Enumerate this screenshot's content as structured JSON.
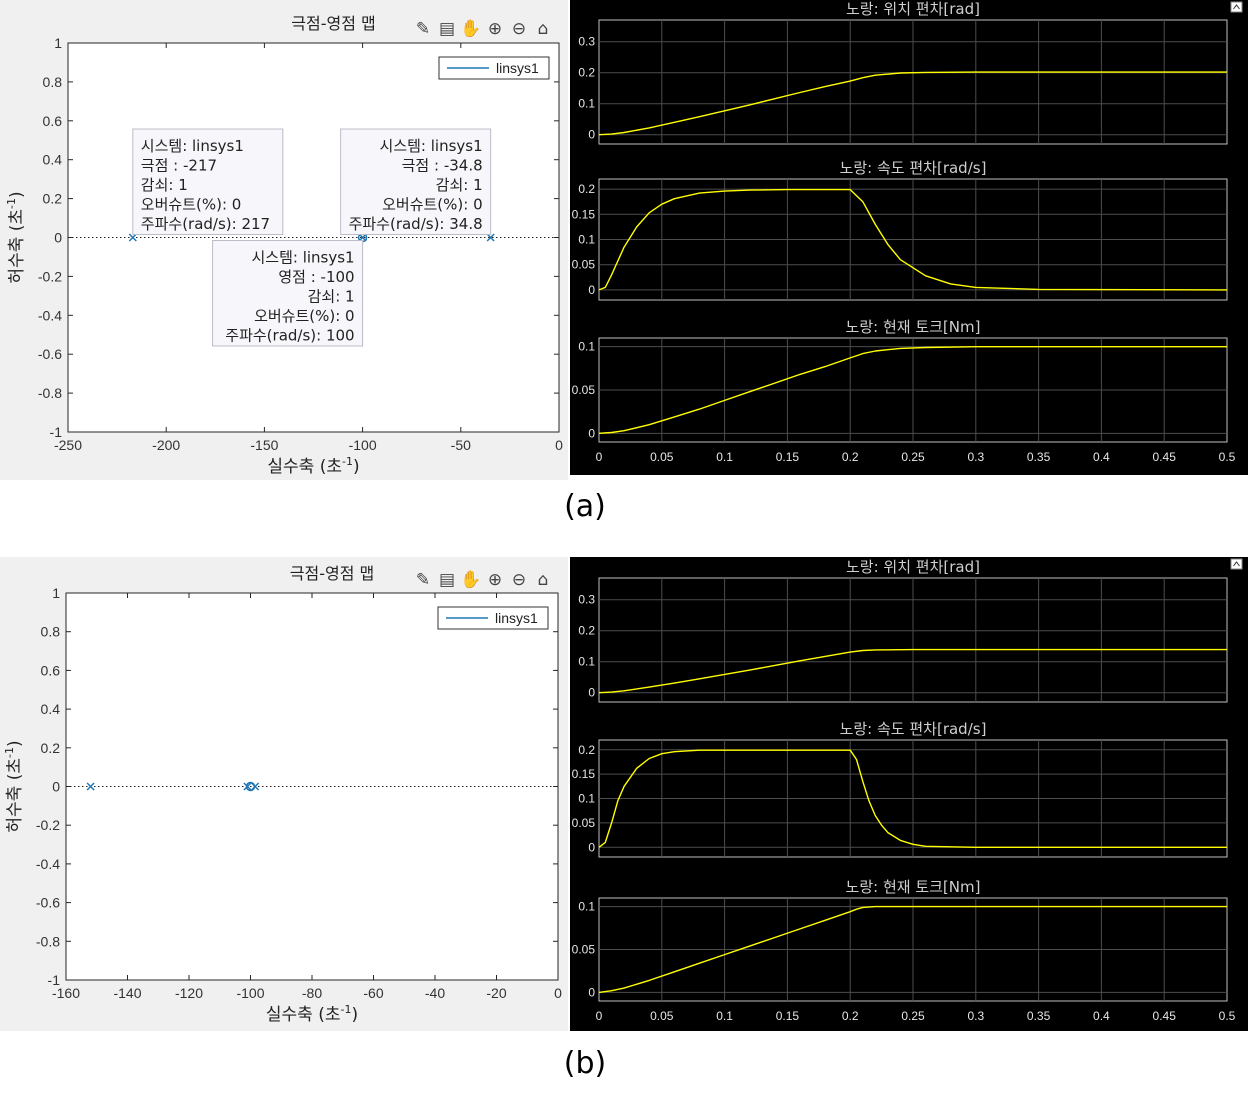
{
  "captions": {
    "a": "(a)",
    "b": "(b)"
  },
  "toolbar_icons": [
    "brush-icon",
    "datatip-icon",
    "pan-hand-icon",
    "zoom-in-icon",
    "zoom-out-icon",
    "home-icon"
  ],
  "scope_toolbar_icon": "undock-icon",
  "colors": {
    "pz_series": "#1f77b4",
    "scope_trace": "#ffff00",
    "scope_bg": "#000000",
    "pz_bg": "#ffffff"
  },
  "figures": [
    {
      "id": "a",
      "chart_data": [
        {
          "type": "scatter",
          "title": "극점-영점 맵",
          "xlabel": "실수축  (초",
          "xlabel_sup": "-1",
          "xlabel_close": ")",
          "ylabel": "허수축  (초",
          "ylabel_sup": "-1",
          "ylabel_close": ")",
          "xlim": [
            -250,
            0
          ],
          "ylim": [
            -1,
            1
          ],
          "xticks": [
            "-250",
            "-200",
            "-150",
            "-100",
            "-50",
            "0"
          ],
          "yticks": [
            "1",
            "0.8",
            "0.6",
            "0.4",
            "0.2",
            "0",
            "-0.2",
            "-0.4",
            "-0.6",
            "-0.8",
            "-1"
          ],
          "legend": {
            "label": "linsys1",
            "placement": "top-right"
          },
          "series": [
            {
              "name": "linsys1",
              "poles": [
                {
                  "x": -217,
                  "y": 0
                },
                {
                  "x": -34.8,
                  "y": 0
                },
                {
                  "x": -100,
                  "y": 0
                }
              ],
              "zeros": [
                {
                  "x": -100,
                  "y": 0
                }
              ]
            }
          ],
          "annotations": [
            {
              "anchor_x": -217,
              "anchor_y": 0,
              "align": "left",
              "lines": [
                "시스템: linsys1",
                "극점 : -217",
                "감쇠: 1",
                "오버슈트(%): 0",
                "주파수(rad/s): 217"
              ]
            },
            {
              "anchor_x": -34.8,
              "anchor_y": 0,
              "align": "right",
              "lines": [
                "시스템: linsys1",
                "극점 : -34.8",
                "감쇠: 1",
                "오버슈트(%): 0",
                "주파수(rad/s): 34.8"
              ]
            },
            {
              "anchor_x": -100,
              "anchor_y": 0,
              "align": "right",
              "lines": [
                "시스템: linsys1",
                "영점 : -100",
                "감쇠: 1",
                "오버슈트(%): 0",
                "주파수(rad/s): 100"
              ]
            }
          ]
        },
        {
          "type": "line",
          "title": "노랑: 위치 편차[rad]",
          "xlim": [
            0,
            0.5
          ],
          "ylim": [
            -0.03,
            0.37
          ],
          "yticks": [
            "0.3",
            "0.2",
            "0.1",
            "0"
          ],
          "series": [
            {
              "x": [
                0,
                0.01,
                0.02,
                0.04,
                0.06,
                0.08,
                0.1,
                0.12,
                0.14,
                0.16,
                0.18,
                0.2,
                0.21,
                0.22,
                0.24,
                0.26,
                0.3,
                0.35,
                0.5
              ],
              "y": [
                0,
                0.002,
                0.007,
                0.022,
                0.04,
                0.058,
                0.077,
                0.096,
                0.116,
                0.136,
                0.155,
                0.173,
                0.184,
                0.192,
                0.199,
                0.201,
                0.202,
                0.202,
                0.202
              ]
            }
          ]
        },
        {
          "type": "line",
          "title": "노랑: 속도 편차[rad/s]",
          "xlim": [
            0,
            0.5
          ],
          "ylim": [
            -0.02,
            0.22
          ],
          "yticks": [
            "0.2",
            "0.15",
            "0.1",
            "0.05",
            "0"
          ],
          "series": [
            {
              "x": [
                0,
                0.005,
                0.01,
                0.02,
                0.03,
                0.04,
                0.05,
                0.06,
                0.08,
                0.1,
                0.12,
                0.15,
                0.2,
                0.21,
                0.22,
                0.23,
                0.24,
                0.26,
                0.28,
                0.3,
                0.35,
                0.5
              ],
              "y": [
                0,
                0.005,
                0.03,
                0.085,
                0.125,
                0.153,
                0.17,
                0.181,
                0.192,
                0.196,
                0.198,
                0.199,
                0.199,
                0.175,
                0.13,
                0.09,
                0.06,
                0.028,
                0.012,
                0.005,
                0.001,
                0
              ]
            }
          ]
        },
        {
          "type": "line",
          "title": "노랑: 현재 토크[Nm]",
          "xlim": [
            0,
            0.5
          ],
          "xticks": [
            "0",
            "0.05",
            "0.1",
            "0.15",
            "0.2",
            "0.25",
            "0.3",
            "0.35",
            "0.4",
            "0.45",
            "0.5"
          ],
          "ylim": [
            -0.01,
            0.11
          ],
          "yticks": [
            "0.1",
            "0.05",
            "0"
          ],
          "series": [
            {
              "x": [
                0,
                0.01,
                0.02,
                0.04,
                0.06,
                0.08,
                0.1,
                0.12,
                0.14,
                0.16,
                0.18,
                0.2,
                0.21,
                0.22,
                0.24,
                0.26,
                0.3,
                0.35,
                0.5
              ],
              "y": [
                0,
                0.001,
                0.003,
                0.01,
                0.019,
                0.028,
                0.038,
                0.048,
                0.058,
                0.068,
                0.077,
                0.087,
                0.092,
                0.095,
                0.098,
                0.099,
                0.1,
                0.1,
                0.1
              ]
            }
          ]
        }
      ]
    },
    {
      "id": "b",
      "chart_data": [
        {
          "type": "scatter",
          "title": "극점-영점 맵",
          "xlabel": "실수축  (초",
          "xlabel_sup": "-1",
          "xlabel_close": ")",
          "ylabel": "허수축  (초",
          "ylabel_sup": "-1",
          "ylabel_close": ")",
          "xlim": [
            -160,
            0
          ],
          "ylim": [
            -1,
            1
          ],
          "xticks": [
            "-160",
            "-140",
            "-120",
            "-100",
            "-80",
            "-60",
            "-40",
            "-20",
            "0"
          ],
          "yticks": [
            "1",
            "0.8",
            "0.6",
            "0.4",
            "0.2",
            "0",
            "-0.2",
            "-0.4",
            "-0.6",
            "-0.8",
            "-1"
          ],
          "legend": {
            "label": "linsys1",
            "placement": "top-right"
          },
          "series": [
            {
              "name": "linsys1",
              "poles": [
                {
                  "x": -152,
                  "y": 0
                },
                {
                  "x": -101,
                  "y": 0
                },
                {
                  "x": -98.5,
                  "y": 0
                }
              ],
              "zeros": [
                {
                  "x": -100,
                  "y": 0
                }
              ]
            }
          ],
          "annotations": []
        },
        {
          "type": "line",
          "title": "노랑: 위치 편차[rad]",
          "xlim": [
            0,
            0.5
          ],
          "ylim": [
            -0.03,
            0.37
          ],
          "yticks": [
            "0.3",
            "0.2",
            "0.1",
            "0"
          ],
          "series": [
            {
              "x": [
                0,
                0.01,
                0.02,
                0.04,
                0.06,
                0.08,
                0.1,
                0.12,
                0.14,
                0.16,
                0.18,
                0.2,
                0.21,
                0.22,
                0.25,
                0.3,
                0.5
              ],
              "y": [
                0,
                0.002,
                0.006,
                0.018,
                0.031,
                0.045,
                0.059,
                0.073,
                0.088,
                0.103,
                0.117,
                0.131,
                0.136,
                0.138,
                0.139,
                0.139,
                0.139
              ]
            }
          ]
        },
        {
          "type": "line",
          "title": "노랑: 속도 편차[rad/s]",
          "xlim": [
            0,
            0.5
          ],
          "ylim": [
            -0.02,
            0.22
          ],
          "yticks": [
            "0.2",
            "0.15",
            "0.1",
            "0.05",
            "0"
          ],
          "series": [
            {
              "x": [
                0,
                0.005,
                0.01,
                0.015,
                0.02,
                0.03,
                0.04,
                0.05,
                0.06,
                0.08,
                0.2,
                0.205,
                0.21,
                0.215,
                0.22,
                0.225,
                0.23,
                0.24,
                0.25,
                0.26,
                0.3,
                0.5
              ],
              "y": [
                0,
                0.01,
                0.05,
                0.095,
                0.125,
                0.162,
                0.182,
                0.192,
                0.196,
                0.199,
                0.199,
                0.18,
                0.135,
                0.095,
                0.065,
                0.045,
                0.03,
                0.014,
                0.006,
                0.002,
                0,
                0
              ]
            }
          ]
        },
        {
          "type": "line",
          "title": "노랑: 현재 토크[Nm]",
          "xlim": [
            0,
            0.5
          ],
          "xticks": [
            "0",
            "0.05",
            "0.1",
            "0.15",
            "0.2",
            "0.25",
            "0.3",
            "0.35",
            "0.4",
            "0.45",
            "0.5"
          ],
          "ylim": [
            -0.01,
            0.11
          ],
          "yticks": [
            "0.1",
            "0.05",
            "0"
          ],
          "series": [
            {
              "x": [
                0,
                0.01,
                0.02,
                0.04,
                0.06,
                0.08,
                0.1,
                0.12,
                0.14,
                0.16,
                0.18,
                0.2,
                0.205,
                0.21,
                0.22,
                0.25,
                0.5
              ],
              "y": [
                0,
                0.002,
                0.005,
                0.014,
                0.024,
                0.034,
                0.044,
                0.054,
                0.064,
                0.074,
                0.084,
                0.094,
                0.097,
                0.099,
                0.1,
                0.1,
                0.1
              ]
            }
          ]
        }
      ]
    }
  ]
}
